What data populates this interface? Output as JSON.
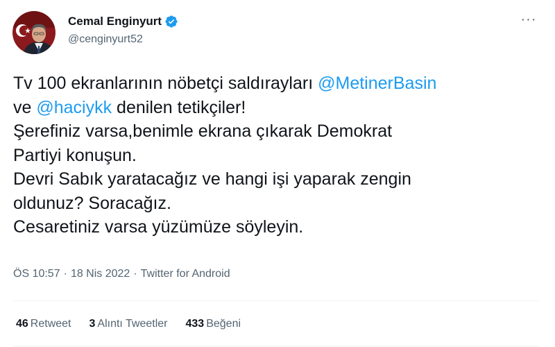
{
  "author": {
    "display_name": "Cemal Enginyurt",
    "handle": "@cenginyurt52",
    "verified": true
  },
  "menu": {
    "more_icon": "more-horizontal-icon",
    "more_glyph": "···"
  },
  "tweet": {
    "line1": {
      "text": "Tv 100 ekranlarının nöbetçi saldırayları ",
      "mention": "@MetinerBasin"
    },
    "line2": {
      "prefix": "ve ",
      "mention": "@haciykk",
      "suffix": " denilen tetikçiler!"
    },
    "line3": "Şerefiniz varsa,benimle ekrana çıkarak Demokrat",
    "line4": "Partiyi konuşun.",
    "line5": "Devri Sabık yaratacağız ve hangi işi yaparak zengin",
    "line6": "oldunuz? Soracağız.",
    "line7": "Cesaretiniz varsa yüzümüze söyleyin."
  },
  "meta": {
    "time": "ÖS 10:57",
    "separator": "·",
    "date": "18 Nis 2022",
    "source": "Twitter for Android"
  },
  "stats": {
    "retweets": {
      "count": "46",
      "label": "Retweet"
    },
    "quotes": {
      "count": "3",
      "label": "Alıntı Tweetler"
    },
    "likes": {
      "count": "433",
      "label": "Beğeni"
    }
  },
  "colors": {
    "accent": "#1d9bf0",
    "text": "#0f1419",
    "secondary": "#536471",
    "divider": "#eff3f4"
  }
}
